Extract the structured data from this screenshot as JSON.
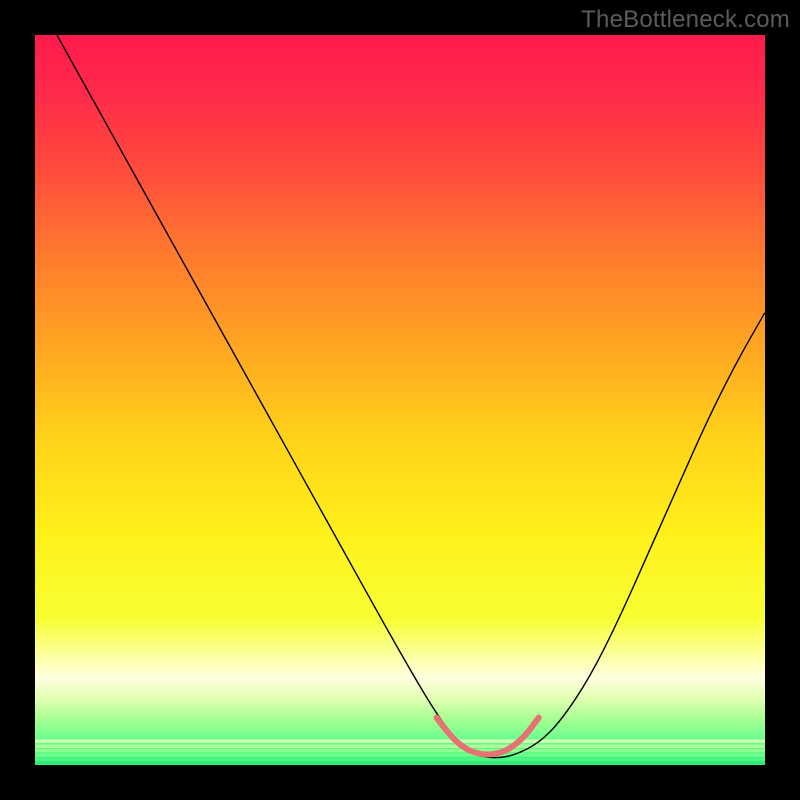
{
  "watermark": "TheBottleneck.com",
  "chart_data": {
    "type": "line",
    "title": "",
    "xlabel": "",
    "ylabel": "",
    "xlim": [
      0,
      100
    ],
    "ylim": [
      0,
      100
    ],
    "legend": false,
    "grid": false,
    "background_gradient": {
      "stops": [
        {
          "offset": 0.0,
          "color": "#ff1a4d"
        },
        {
          "offset": 0.08,
          "color": "#ff2a4a"
        },
        {
          "offset": 0.18,
          "color": "#ff4a3d"
        },
        {
          "offset": 0.3,
          "color": "#ff7a2e"
        },
        {
          "offset": 0.42,
          "color": "#ffa322"
        },
        {
          "offset": 0.55,
          "color": "#ffd21a"
        },
        {
          "offset": 0.68,
          "color": "#fff01a"
        },
        {
          "offset": 0.8,
          "color": "#f7ff33"
        },
        {
          "offset": 0.88,
          "color": "#ffffe0"
        },
        {
          "offset": 0.91,
          "color": "#e0ffb0"
        },
        {
          "offset": 0.94,
          "color": "#a0ff90"
        },
        {
          "offset": 0.97,
          "color": "#60ff90"
        },
        {
          "offset": 1.0,
          "color": "#20e870"
        }
      ]
    },
    "bottom_stripes": [
      {
        "y": 96.5,
        "color": "#d8ffb0"
      },
      {
        "y": 97.2,
        "color": "#b8ff9a"
      },
      {
        "y": 97.8,
        "color": "#98ff90"
      },
      {
        "y": 98.4,
        "color": "#78ff8c"
      },
      {
        "y": 99.0,
        "color": "#50f884"
      },
      {
        "y": 99.6,
        "color": "#30ea78"
      }
    ],
    "series": [
      {
        "name": "bottleneck-curve",
        "color": "#000000",
        "stroke_width": 1.4,
        "x": [
          3,
          8,
          13,
          18,
          23,
          28,
          33,
          38,
          43,
          48,
          52,
          55,
          58,
          60,
          62,
          64,
          66,
          69,
          72,
          76,
          80,
          84,
          88,
          92,
          96,
          100
        ],
        "y": [
          100,
          91,
          82,
          73,
          64,
          55,
          46,
          37,
          28,
          19,
          12,
          7,
          3,
          1.5,
          1.0,
          1.0,
          1.5,
          3,
          6,
          12,
          20,
          29,
          38,
          47,
          55,
          62
        ]
      },
      {
        "name": "highlight-valley",
        "color": "#e57373",
        "stroke_width": 6,
        "linecap": "round",
        "x": [
          55,
          57,
          59,
          60.5,
          62,
          63.5,
          65,
          67,
          69
        ],
        "y": [
          6.5,
          3.8,
          2.2,
          1.6,
          1.4,
          1.6,
          2.2,
          3.8,
          6.5
        ]
      }
    ]
  }
}
